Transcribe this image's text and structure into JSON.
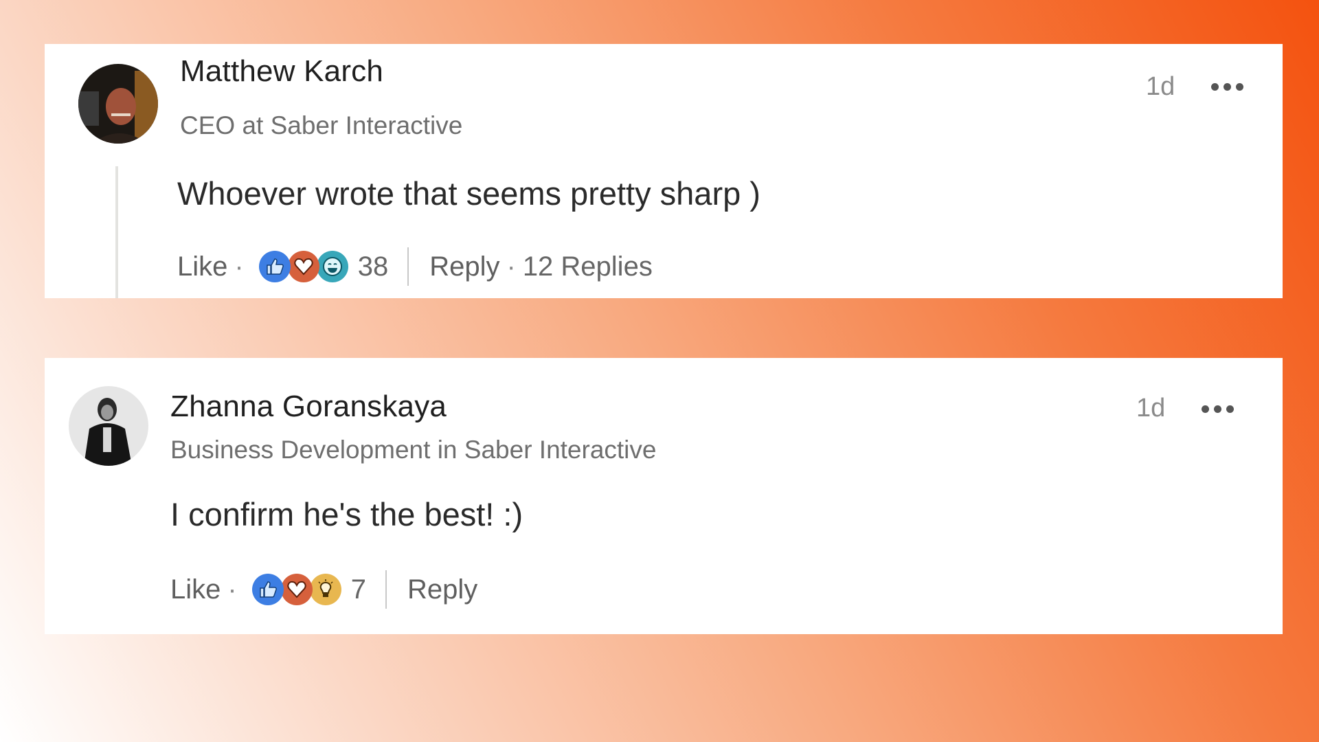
{
  "comments": [
    {
      "author": "Matthew Karch",
      "headline": "CEO at Saber Interactive",
      "time": "1d",
      "text": "Whoever wrote that seems pretty sharp )",
      "actions": {
        "like_label": "Like",
        "reactions": [
          "like",
          "love",
          "funny"
        ],
        "reaction_count": "38",
        "reply_label": "Reply",
        "replies_label": "12 Replies"
      }
    },
    {
      "author": "Zhanna Goranskaya",
      "headline": "Business Development in Saber Interactive",
      "time": "1d",
      "text": "I confirm he's the best! :)",
      "actions": {
        "like_label": "Like",
        "reactions": [
          "like",
          "love",
          "insightful"
        ],
        "reaction_count": "7",
        "reply_label": "Reply"
      }
    }
  ],
  "separator": "·",
  "colors": {
    "background_start": "#ffffff",
    "background_end": "#f4520f",
    "like": "#3d7ee3",
    "love": "#d6603c",
    "funny": "#38a7b9",
    "insightful": "#e8b750"
  }
}
